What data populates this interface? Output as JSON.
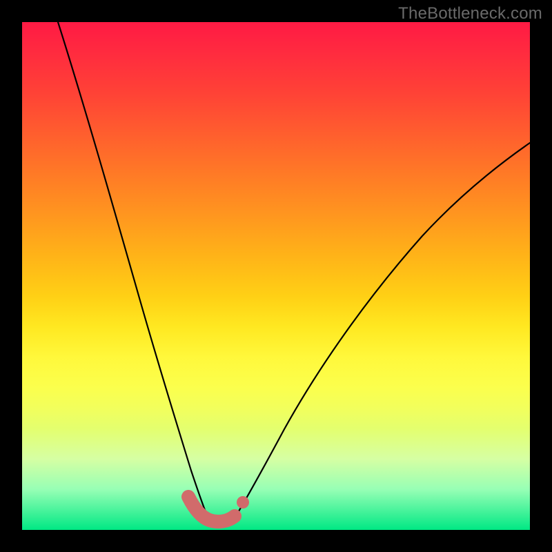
{
  "watermark": "TheBottleneck.com",
  "colors": {
    "frame": "#000000",
    "curve": "#000000",
    "highlight": "#d16b6b",
    "gradient_top": "#ff1a44",
    "gradient_bottom": "#00e884"
  },
  "chart_data": {
    "type": "line",
    "title": "",
    "xlabel": "",
    "ylabel": "",
    "xlim": [
      0,
      100
    ],
    "ylim": [
      0,
      100
    ],
    "grid": false,
    "legend": false,
    "series": [
      {
        "name": "bottleneck-curve-left",
        "x": [
          7,
          10,
          13,
          16,
          19,
          22,
          25,
          27,
          29,
          31,
          33,
          34,
          35,
          36
        ],
        "y": [
          100,
          90,
          79,
          67,
          55,
          43,
          32,
          24,
          17,
          11,
          6,
          4,
          3,
          2
        ]
      },
      {
        "name": "bottleneck-curve-right",
        "x": [
          42,
          44,
          47,
          51,
          56,
          62,
          69,
          77,
          86,
          95,
          100
        ],
        "y": [
          2,
          4,
          8,
          14,
          22,
          31,
          41,
          51,
          61,
          70,
          74
        ]
      },
      {
        "name": "sweet-spot-highlight",
        "x": [
          33,
          35,
          37,
          39,
          41,
          42
        ],
        "y": [
          6,
          3,
          2,
          2,
          3,
          4
        ]
      }
    ],
    "markers": [
      {
        "name": "highlight-end-dot",
        "x": 43,
        "y": 6
      }
    ]
  }
}
